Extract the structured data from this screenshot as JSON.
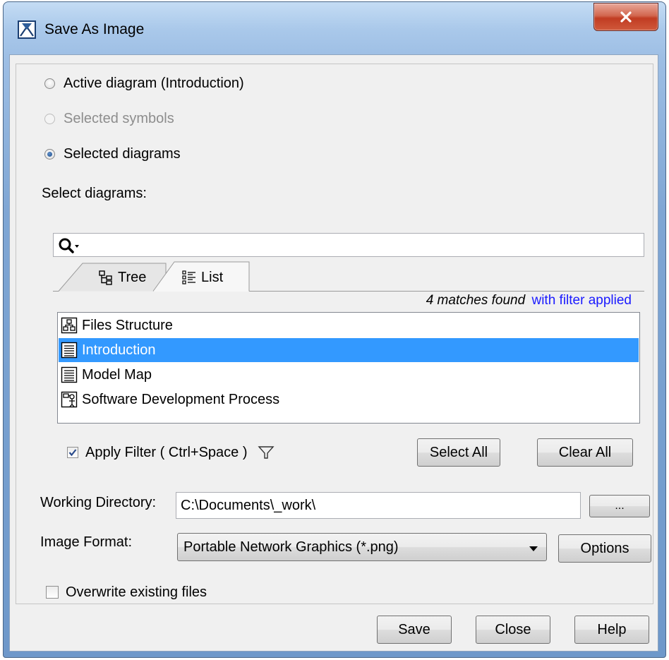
{
  "window": {
    "title": "Save As Image",
    "close_label": "x"
  },
  "scope": {
    "options": [
      {
        "label": "Active diagram (Introduction)",
        "checked": false,
        "disabled": false
      },
      {
        "label": "Selected symbols",
        "checked": false,
        "disabled": true
      },
      {
        "label": "Selected diagrams",
        "checked": true,
        "disabled": false
      }
    ]
  },
  "select_diagrams": {
    "label": "Select diagrams:",
    "search_value": "",
    "tabs": [
      {
        "label": "Tree",
        "icon": "tree-icon",
        "active": false
      },
      {
        "label": "List",
        "icon": "list-icon",
        "active": true
      }
    ],
    "match_count": "4 matches found",
    "match_filter_note": "with filter applied",
    "items": [
      {
        "label": "Files Structure",
        "icon": "package-diagram-icon",
        "selected": false
      },
      {
        "label": "Introduction",
        "icon": "content-diagram-icon",
        "selected": true
      },
      {
        "label": "Model Map",
        "icon": "content-diagram-icon",
        "selected": false
      },
      {
        "label": "Software Development Process",
        "icon": "process-diagram-icon",
        "selected": false
      }
    ],
    "apply_filter_label": "Apply Filter ( Ctrl+Space )",
    "apply_filter_checked": true,
    "select_all_label": "Select All",
    "clear_all_label": "Clear All"
  },
  "working_directory": {
    "label": "Working Directory:",
    "value": "C:\\Documents\\_work\\",
    "browse_label": "..."
  },
  "image_format": {
    "label": "Image Format:",
    "value": "Portable Network Graphics (*.png)",
    "options_label": "Options"
  },
  "overwrite": {
    "label": "Overwrite existing files",
    "checked": false
  },
  "footer": {
    "save_label": "Save",
    "close_label": "Close",
    "help_label": "Help"
  },
  "colors": {
    "selection": "#3399ff",
    "link_blue": "#1a1aff",
    "dialog_bg": "#f0f0f0",
    "close_red": "#c13c22"
  }
}
